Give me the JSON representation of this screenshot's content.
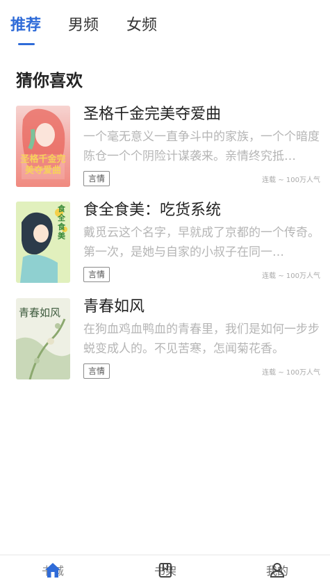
{
  "tabs": [
    {
      "label": "推荐",
      "active": true
    },
    {
      "label": "男频",
      "active": false
    },
    {
      "label": "女频",
      "active": false
    }
  ],
  "section": {
    "title": "猜你喜欢"
  },
  "books": [
    {
      "title": "圣格千金完美夺爱曲",
      "description": "一个毫无意义一直争斗中的家族，一个个暗度陈仓一个个阴险计谋袭来。亲情终究抵…",
      "tag": "言情",
      "meta": "连载 ~ 100万人气",
      "cover_text": "圣格千金完美夺爱曲"
    },
    {
      "title": "食全食美：吃货系统",
      "description": "戴觅云这个名字，早就成了京都的一个传奇。 第一次，是她与自家的小叔子在同一…",
      "tag": "言情",
      "meta": "连载 ~ 100万人气",
      "cover_text": "食全食美"
    },
    {
      "title": "青春如风",
      "description": "在狗血鸡血鸭血的青春里，我们是如何一步步蜕变成人的。不见苦寒，怎闻菊花香。",
      "tag": "言情",
      "meta": "连载 ~ 100万人气",
      "cover_text": "青春如风"
    }
  ],
  "bottom_nav": [
    {
      "label": "书城",
      "icon": "home-icon",
      "active": true
    },
    {
      "label": "书架",
      "icon": "bookshelf-icon",
      "active": false
    },
    {
      "label": "我的",
      "icon": "profile-icon",
      "active": false
    }
  ],
  "colors": {
    "accent": "#2f6bd8",
    "muted_text": "#b5b5b5",
    "title_text": "#222222"
  }
}
